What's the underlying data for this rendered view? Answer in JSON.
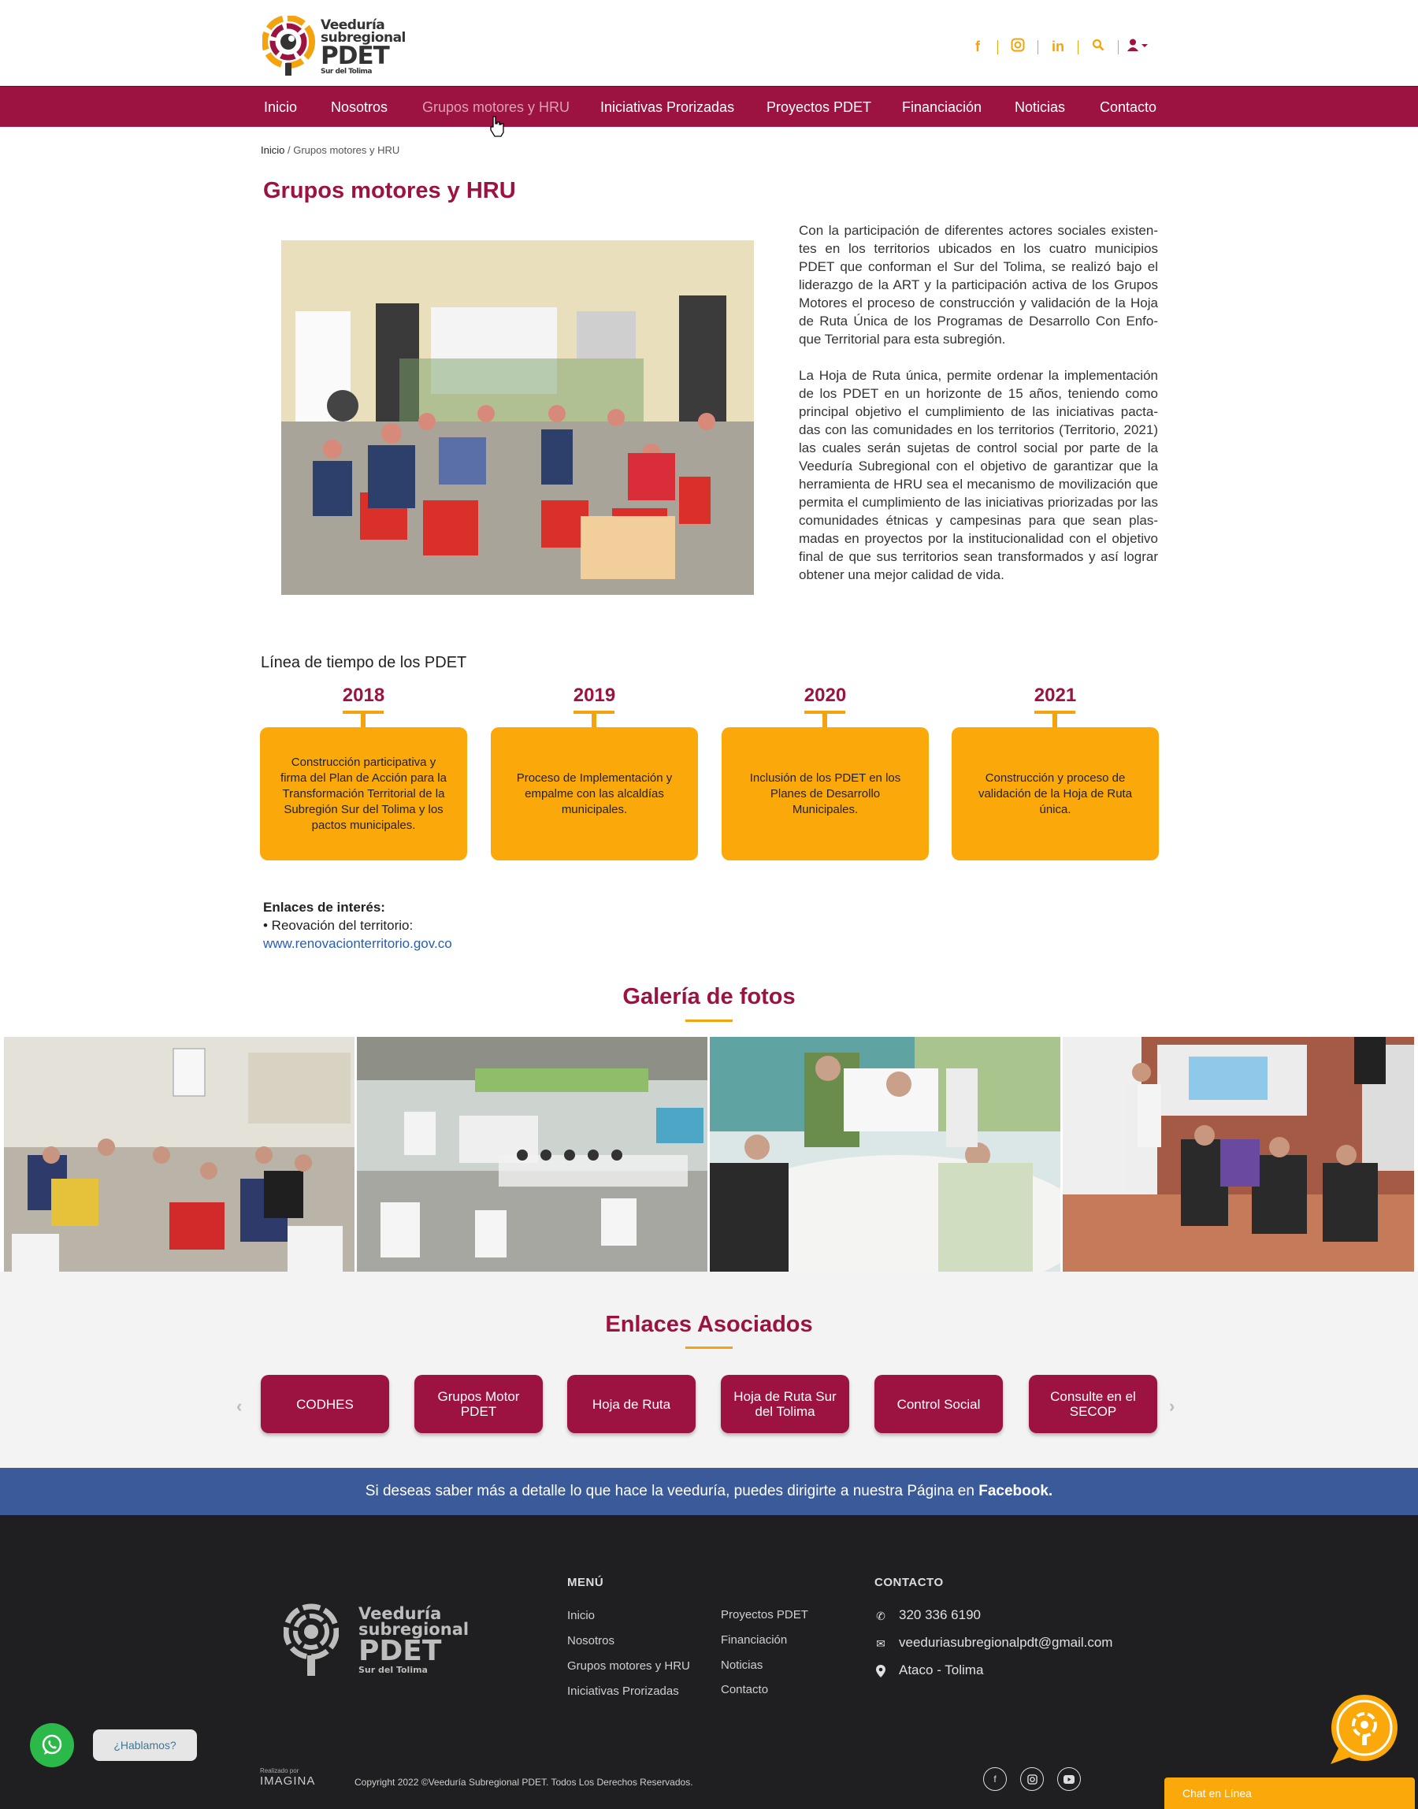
{
  "brand": {
    "name_line1": "Veeduría",
    "name_line2": "subregional",
    "name_line3": "PDET",
    "name_line4": "Sur del Tolima"
  },
  "header": {
    "social": [
      "facebook-icon",
      "instagram-icon",
      "linkedin-icon",
      "search-icon",
      "user-icon"
    ],
    "accent_color": "#f3a30d"
  },
  "nav": {
    "items": [
      "Inicio",
      "Nosotros",
      "Grupos motores y HRU",
      "Iniciativas Prorizadas",
      "Proyectos PDET",
      "Financiación",
      "Noticias",
      "Contacto"
    ],
    "active_index": 2,
    "background": "#9c1240"
  },
  "breadcrumb": {
    "home": "Inicio",
    "separator": " / ",
    "current": "Grupos motores y HRU"
  },
  "page": {
    "title": "Grupos motores y HRU",
    "intro_p1": "Con la participación de diferentes actores sociales existen-tes en los territorios ubicados en los cuatro municipios PDET que conforman el Sur del Tolima, se realizó bajo el liderazgo de la ART y la participación activa de los Grupos Motores el proceso de construcción y validación de la Hoja de Ruta Única de los Programas de Desarrollo Con Enfo-que Territorial para esta subregión.",
    "intro_p2": "La Hoja de Ruta única, permite ordenar la implementación de los PDET en un horizonte de 15 años, teniendo como principal objetivo el cumplimiento de las iniciativas pacta-das con las comunidades en los territorios (Territorio, 2021) las cuales serán sujetas de control social por parte de la Veeduría Subregional con el objetivo de garantizar que la herramienta de HRU sea el mecanismo de movilización que permita el  cumplimiento de las iniciativas priorizadas por las comunidades étnicas y campesinas para que sean plas-madas en proyectos por la institucionalidad  con el objetivo final de que sus territorios sean  transformados y así lograr obtener una mejor calidad de vida."
  },
  "timeline": {
    "title": "Línea de tiempo de los PDET",
    "items": [
      {
        "year": "2018",
        "text": "Construcción participativa y firma del Plan de Acción para la Transformación Territorial de la Subregión Sur del Tolima y los pactos municipales."
      },
      {
        "year": "2019",
        "text": "Proceso de Implementación y empalme con las alcaldías municipales."
      },
      {
        "year": "2020",
        "text": "Inclusión de los PDET en los Planes de Desarrollo Municipales."
      },
      {
        "year": "2021",
        "text": "Construcción y proceso de validación de la Hoja de Ruta única."
      }
    ],
    "box_color": "#fba90a"
  },
  "links": {
    "heading": "Enlaces de interés:",
    "item_label": "• Reovación del territorio:",
    "item_url": "www.renovacionterritorio.gov.co"
  },
  "gallery": {
    "title": "Galería de fotos"
  },
  "associated": {
    "title": "Enlaces Asociados",
    "buttons": [
      "CODHES",
      "Grupos Motor PDET",
      "Hoja de Ruta",
      "Hoja de Ruta Sur del Tolima",
      "Control Social",
      "Consulte en el SECOP"
    ]
  },
  "facebook_band": {
    "text": "Si deseas saber más a detalle lo que hace la veeduría, puedes dirigirte a nuestra Página en ",
    "link": "Facebook."
  },
  "footer": {
    "menu_heading": "MENÚ",
    "menu_col1": [
      "Inicio",
      "Nosotros",
      "Grupos motores y HRU",
      "Iniciativas Prorizadas"
    ],
    "menu_col2": [
      "Proyectos PDET",
      "Financiación",
      "Noticias",
      "Contacto"
    ],
    "contact_heading": "CONTACTO",
    "phone": "320 336 6190",
    "email": "veeduriasubregionalpdt@gmail.com",
    "location": "Ataco - Tolima",
    "made_by_label": "Realizado por",
    "made_by_name": "IMAGINA",
    "copyright": "Copyright 2022 ©Veeduría Subregional PDET. Todos Los Derechos Reservados."
  },
  "chat": {
    "whatsapp_label": "¿Hablamos?",
    "chat_label": "Chat en Línea"
  }
}
